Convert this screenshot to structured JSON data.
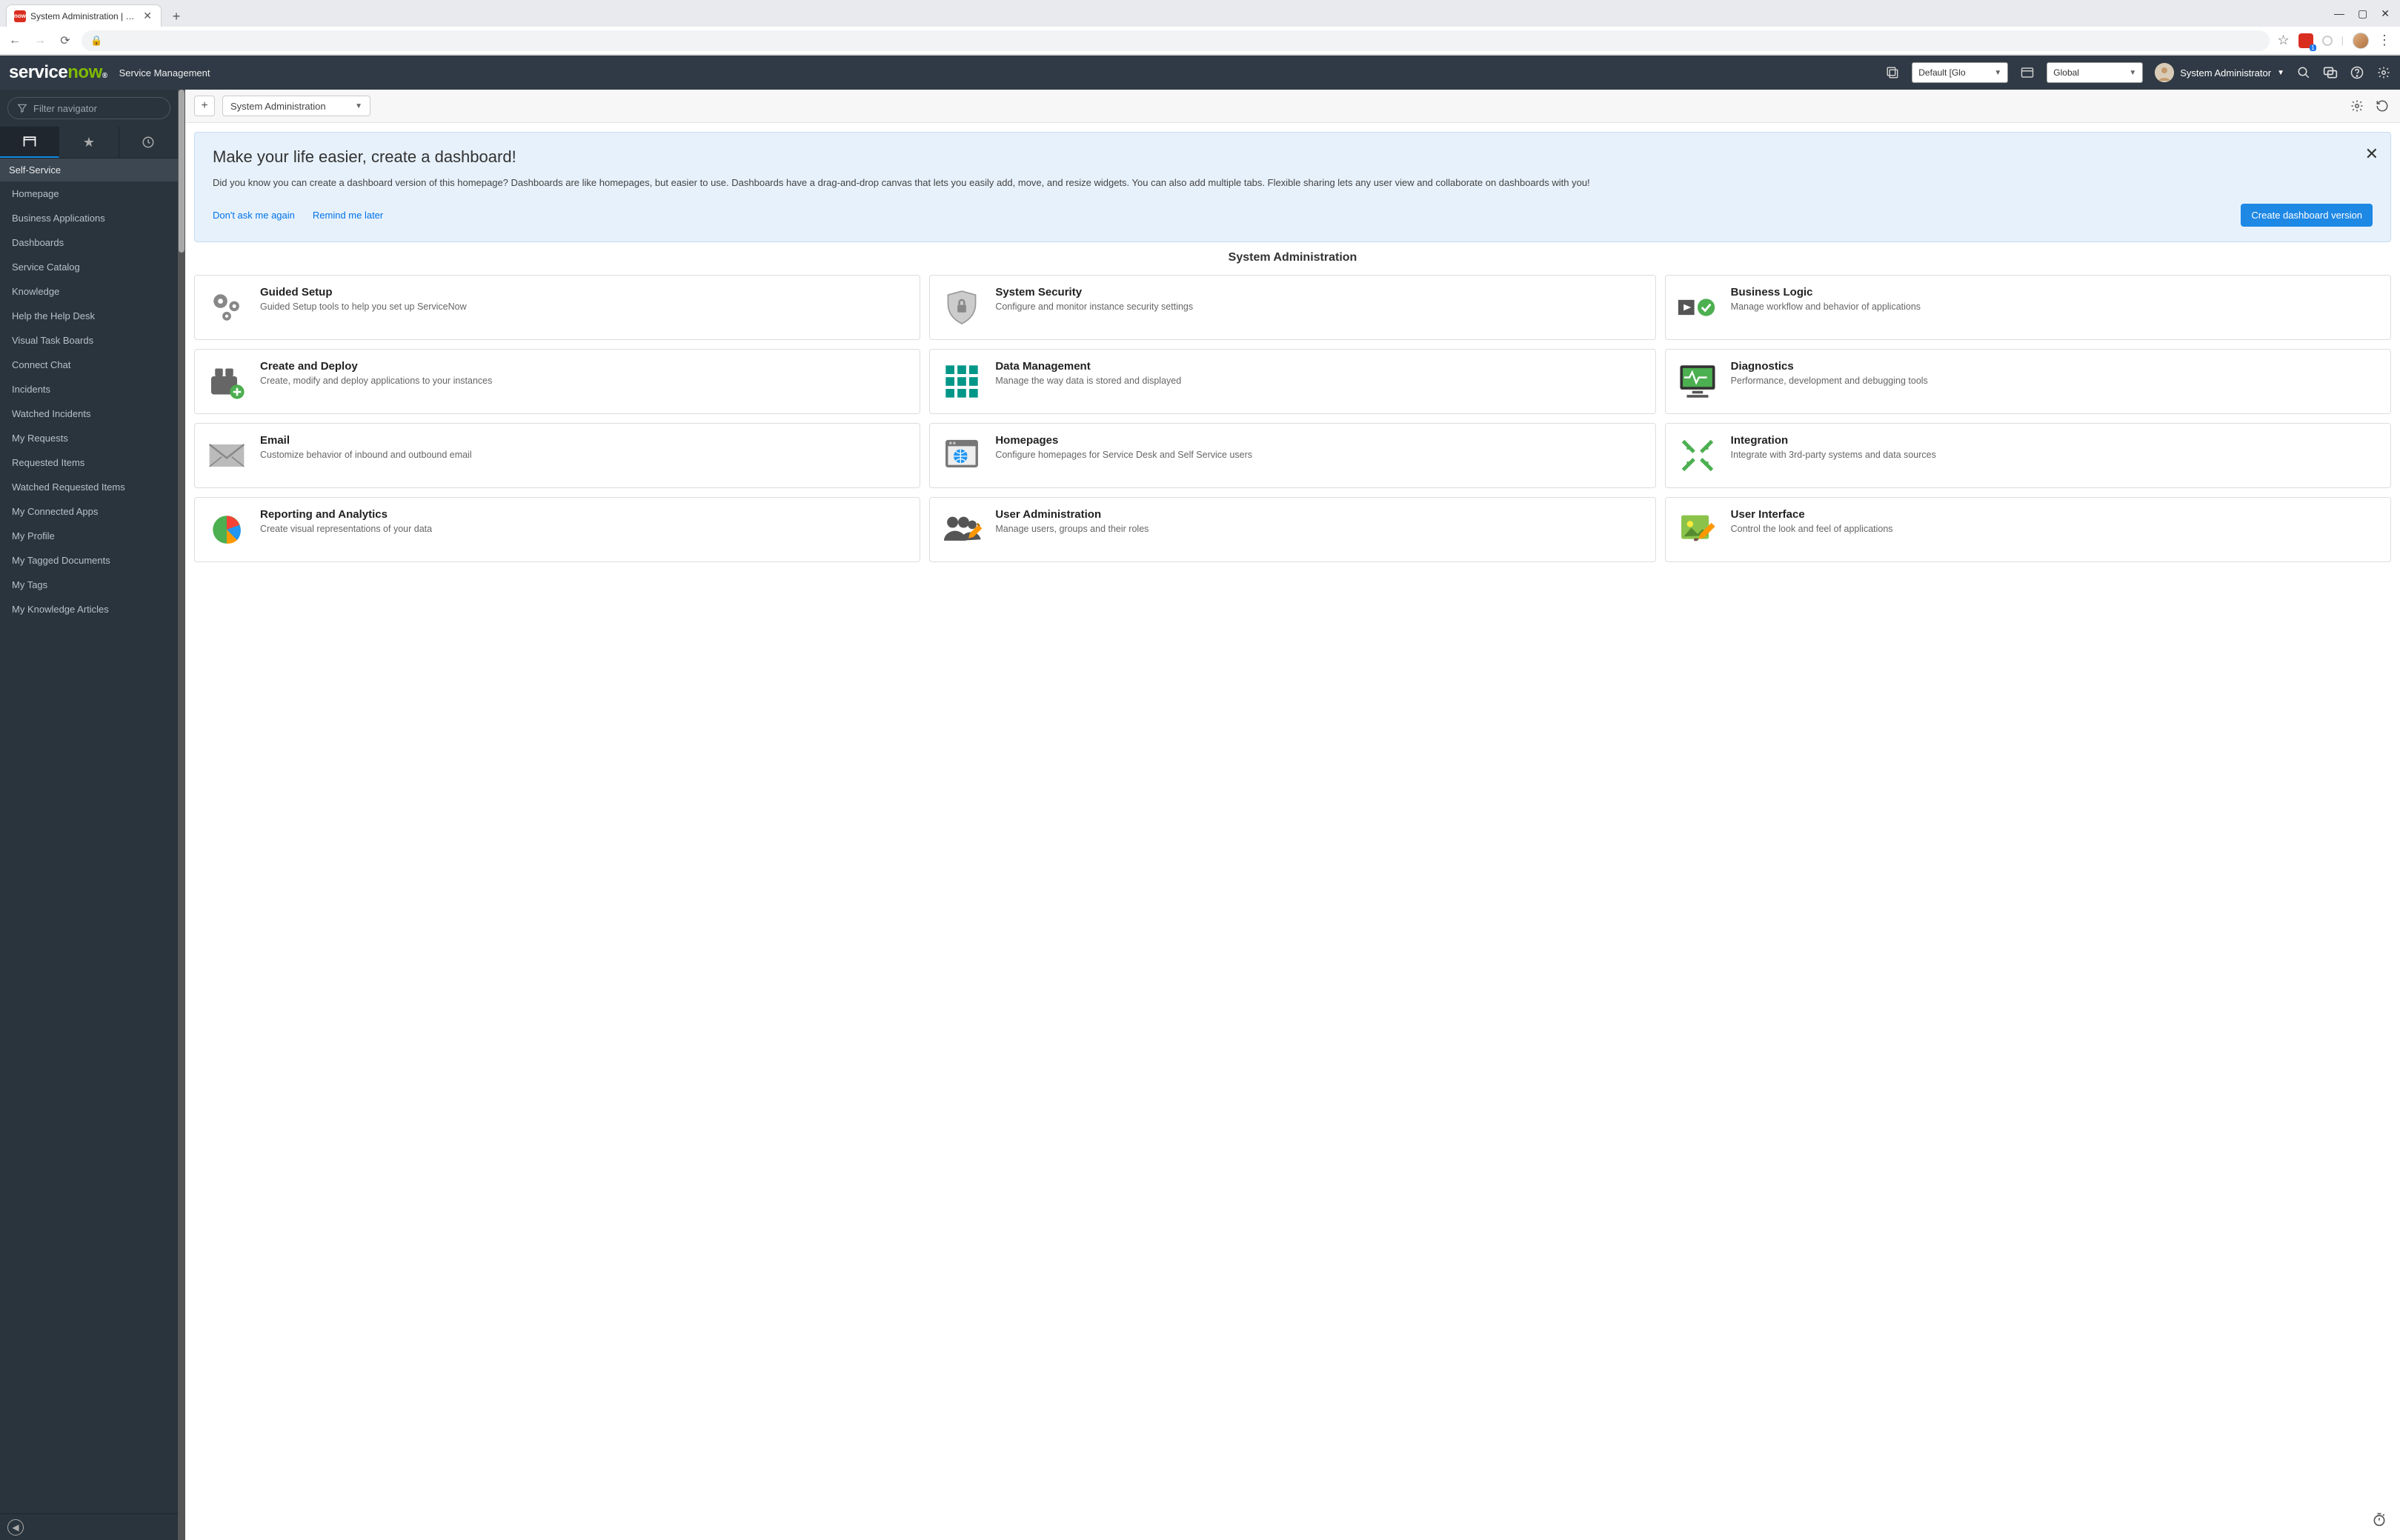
{
  "browser": {
    "tab_title": "System Administration | ServiceN",
    "window_controls": {
      "min": "—",
      "max": "▢",
      "close": "✕"
    }
  },
  "header": {
    "logo_svc": "service",
    "logo_now": "now",
    "subtitle": "Service Management",
    "update_set_label": "Default [Glo",
    "app_scope_label": "Global",
    "user_name": "System Administrator"
  },
  "leftnav": {
    "filter_placeholder": "Filter navigator",
    "section": "Self-Service",
    "items": [
      "Homepage",
      "Business Applications",
      "Dashboards",
      "Service Catalog",
      "Knowledge",
      "Help the Help Desk",
      "Visual Task Boards",
      "Connect Chat",
      "Incidents",
      "Watched Incidents",
      "My Requests",
      "Requested Items",
      "Watched Requested Items",
      "My Connected Apps",
      "My Profile",
      "My Tagged Documents",
      "My Tags",
      "My Knowledge Articles"
    ]
  },
  "toolbar": {
    "add_label": "+",
    "page_select": "System Administration"
  },
  "banner": {
    "title": "Make your life easier, create a dashboard!",
    "body": "Did you know you can create a dashboard version of this homepage? Dashboards are like homepages, but easier to use. Dashboards have a drag-and-drop canvas that lets you easily add, move, and resize widgets. You can also add multiple tabs. Flexible sharing lets any user view and collaborate on dashboards with you!",
    "dont_ask": "Don't ask me again",
    "remind": "Remind me later",
    "cta": "Create dashboard version"
  },
  "page_title": "System Administration",
  "cards": [
    {
      "title": "Guided Setup",
      "desc": "Guided Setup tools to help you set up ServiceNow",
      "icon": "gears"
    },
    {
      "title": "System Security",
      "desc": "Configure and monitor instance security settings",
      "icon": "shield-lock"
    },
    {
      "title": "Business Logic",
      "desc": "Manage workflow and behavior of applications",
      "icon": "play-check"
    },
    {
      "title": "Create and Deploy",
      "desc": "Create, modify and deploy applications to your instances",
      "icon": "blocks-plus"
    },
    {
      "title": "Data Management",
      "desc": "Manage the way data is stored and displayed",
      "icon": "grid-squares"
    },
    {
      "title": "Diagnostics",
      "desc": "Performance, development and debugging tools",
      "icon": "monitor-pulse"
    },
    {
      "title": "Email",
      "desc": "Customize behavior of inbound and outbound email",
      "icon": "envelope"
    },
    {
      "title": "Homepages",
      "desc": "Configure homepages for Service Desk and Self Service users",
      "icon": "browser-globe"
    },
    {
      "title": "Integration",
      "desc": "Integrate with 3rd-party systems and data sources",
      "icon": "arrows-in"
    },
    {
      "title": "Reporting and Analytics",
      "desc": "Create visual representations of your data",
      "icon": "pie-chart"
    },
    {
      "title": "User Administration",
      "desc": "Manage users, groups and their roles",
      "icon": "users-pencil"
    },
    {
      "title": "User Interface",
      "desc": "Control the look and feel of applications",
      "icon": "picture-brush"
    }
  ]
}
